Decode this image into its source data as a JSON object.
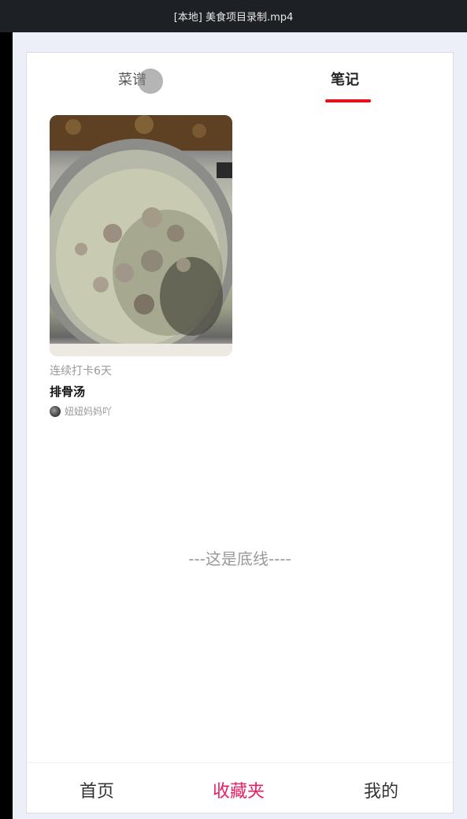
{
  "window": {
    "title": "[本地] 美食项目录制.mp4"
  },
  "tabs": [
    {
      "label": "菜谱",
      "active": false
    },
    {
      "label": "笔记",
      "active": true
    }
  ],
  "accent_color": "#e8101d",
  "card": {
    "streak": "连续打卡6天",
    "title": "排骨汤",
    "author": "妞妞妈妈吖"
  },
  "footer_text": "---这是底线----",
  "bottom_nav": {
    "home": "首页",
    "favorites": "收藏夹",
    "mine": "我的",
    "active_color": "#e91e63"
  }
}
